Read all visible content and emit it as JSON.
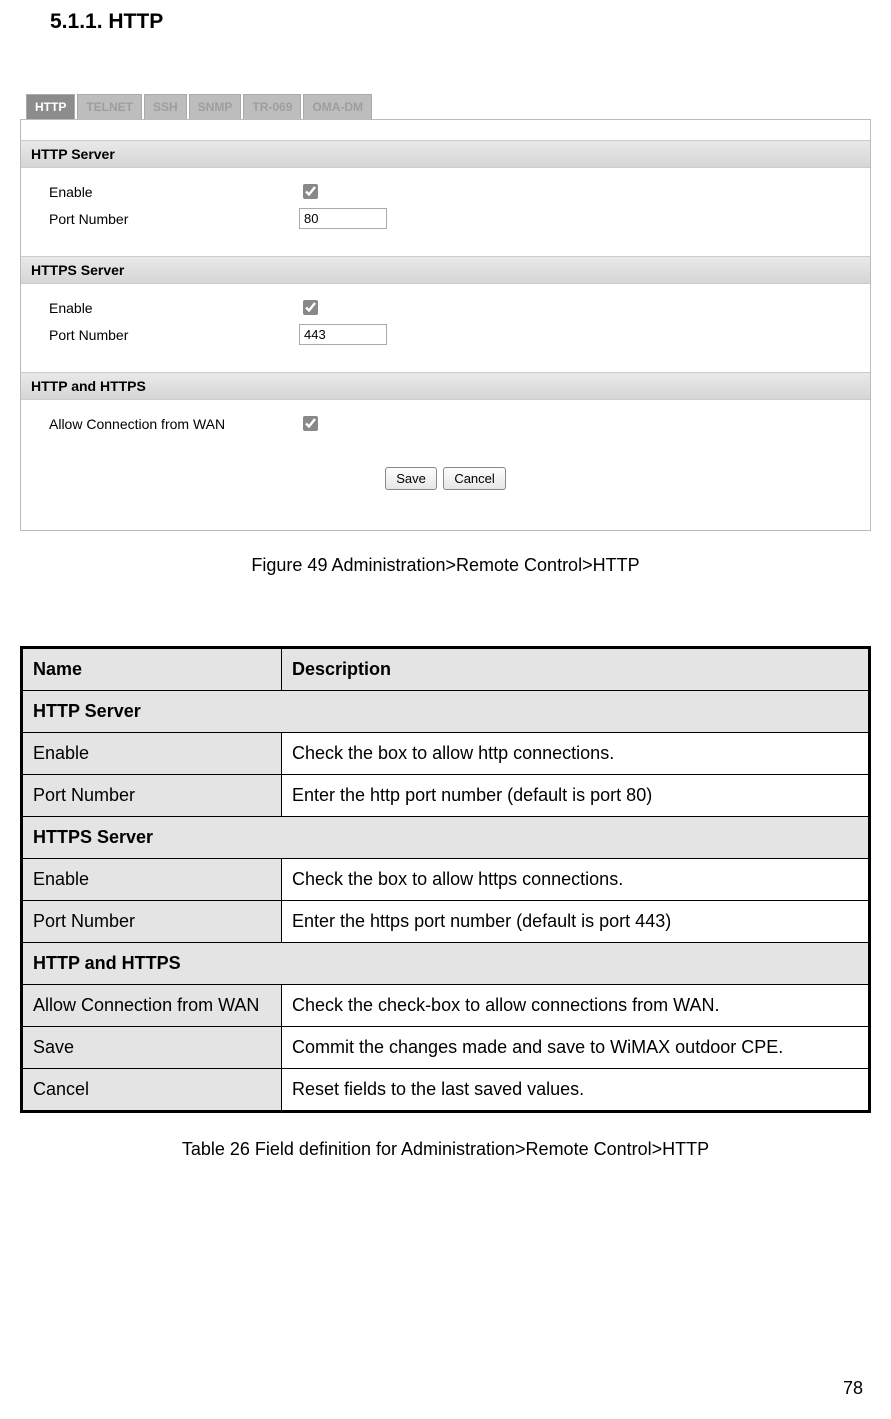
{
  "heading": "5.1.1.  HTTP",
  "tabs": [
    "HTTP",
    "TELNET",
    "SSH",
    "SNMP",
    "TR-069",
    "OMA-DM"
  ],
  "active_tab_index": 0,
  "groups": {
    "http": {
      "title": "HTTP Server",
      "enable_label": "Enable",
      "enable_checked": true,
      "port_label": "Port Number",
      "port_value": "80"
    },
    "https": {
      "title": "HTTPS Server",
      "enable_label": "Enable",
      "enable_checked": true,
      "port_label": "Port Number",
      "port_value": "443"
    },
    "combined": {
      "title": "HTTP and HTTPS",
      "allow_label": "Allow Connection from WAN",
      "allow_checked": true
    }
  },
  "buttons": {
    "save": "Save",
    "cancel": "Cancel"
  },
  "figure_caption": "Figure 49  Administration>Remote Control>HTTP",
  "table": {
    "headers": {
      "name": "Name",
      "desc": "Description"
    },
    "rows": [
      {
        "type": "section",
        "text": "HTTP Server"
      },
      {
        "type": "row",
        "name": "Enable",
        "desc": "Check the box to allow http connections."
      },
      {
        "type": "row",
        "name": "Port Number",
        "desc": "Enter the http port number (default is port 80)"
      },
      {
        "type": "section",
        "text": "HTTPS Server"
      },
      {
        "type": "row",
        "name": "Enable",
        "desc": "Check the box to allow https connections."
      },
      {
        "type": "row",
        "name": "Port Number",
        "desc": "Enter the https port number (default is port 443)"
      },
      {
        "type": "section",
        "text": "HTTP and HTTPS"
      },
      {
        "type": "row",
        "name": "Allow Connection from WAN",
        "desc": "Check the check-box to allow connections from WAN."
      },
      {
        "type": "row",
        "name": "Save",
        "desc": "Commit the changes made and save to WiMAX outdoor CPE."
      },
      {
        "type": "row",
        "name": "Cancel",
        "desc": "Reset fields to the last saved values."
      }
    ]
  },
  "table_caption": "Table 26    Field definition for Administration>Remote Control>HTTP",
  "page_number": "78"
}
